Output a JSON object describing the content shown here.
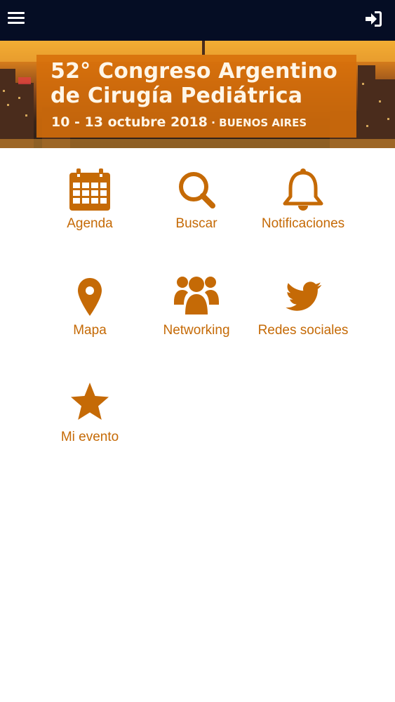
{
  "header": {
    "menu_icon": "hamburger-menu-icon",
    "login_icon": "sign-in-icon",
    "background_color": "#050d24"
  },
  "banner": {
    "title_line1": "52° Congreso Argentino",
    "title_line2": "de Cirugía Pediátrica",
    "dates": "10 - 13 octubre 2018",
    "separator": "·",
    "location": "BUENOS AIRES",
    "box_color": "#d66e0a"
  },
  "accent_color": "#c56a06",
  "menu": {
    "items": [
      {
        "label": "Agenda",
        "icon": "calendar-icon"
      },
      {
        "label": "Buscar",
        "icon": "search-icon"
      },
      {
        "label": "Notificaciones",
        "icon": "bell-icon"
      },
      {
        "label": "Mapa",
        "icon": "map-marker-icon"
      },
      {
        "label": "Networking",
        "icon": "users-icon"
      },
      {
        "label": "Redes sociales",
        "icon": "twitter-icon"
      },
      {
        "label": "Mi evento",
        "icon": "star-icon"
      }
    ]
  }
}
